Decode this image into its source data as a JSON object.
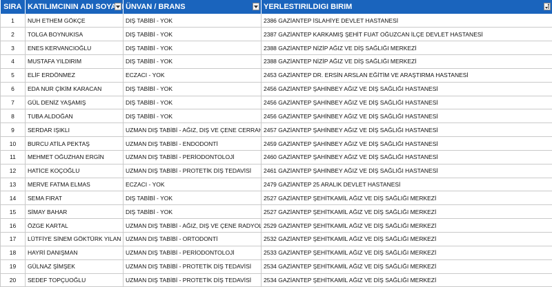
{
  "headers": {
    "sira": "SIRA",
    "name": "KATILIMCININ ADI SOYADI",
    "unvan": "ÜNVAN / BRANS",
    "birim": "YERLESTIRILDIGI BIRIM"
  },
  "icons": {
    "filter": "dropdown-filter-icon",
    "sorted_filter": "sort-filter-icon"
  },
  "colors": {
    "header_bg": "#1a64bd",
    "header_text": "#ffffff",
    "grid": "#c9c9c9"
  },
  "rows": [
    {
      "sira": "1",
      "name": "NUH ETHEM GÖKÇE",
      "unvan": "DIŞ TABİBİ - YOK",
      "birim": "2386 GAZİANTEP İSLAHİYE DEVLET HASTANESİ"
    },
    {
      "sira": "2",
      "name": "TOLGA BOYNUKISA",
      "unvan": "DIŞ TABİBİ - YOK",
      "birim": "2387 GAZİANTEP KARKAMIŞ ŞEHİT FUAT OĞUZCAN İLÇE DEVLET HASTANESİ"
    },
    {
      "sira": "3",
      "name": "ENES KERVANCIOĞLU",
      "unvan": "DIŞ TABİBİ - YOK",
      "birim": "2388 GAZİANTEP NİZİP AĞIZ VE DİŞ SAĞLIĞI MERKEZİ"
    },
    {
      "sira": "4",
      "name": "MUSTAFA YILDIRIM",
      "unvan": "DIŞ TABİBİ - YOK",
      "birim": "2388 GAZİANTEP NİZİP AĞIZ VE DİŞ SAĞLIĞI MERKEZİ"
    },
    {
      "sira": "5",
      "name": "ELİF ERDÖNMEZ",
      "unvan": "ECZACI - YOK",
      "birim": "2453 GAZİANTEP DR. ERSİN ARSLAN EĞİTİM VE ARAŞTIRMA HASTANESİ"
    },
    {
      "sira": "6",
      "name": "EDA NUR ÇİKİM KARACAN",
      "unvan": "DIŞ TABİBİ - YOK",
      "birim": "2456 GAZİANTEP ŞAHİNBEY AĞIZ VE DİŞ SAĞLIĞI HASTANESİ"
    },
    {
      "sira": "7",
      "name": "GÜL DENİZ YAŞAMIŞ",
      "unvan": "DIŞ TABİBİ - YOK",
      "birim": "2456 GAZİANTEP ŞAHİNBEY AĞIZ VE DİŞ SAĞLIĞI HASTANESİ"
    },
    {
      "sira": "8",
      "name": "TUBA ALDOĞAN",
      "unvan": "DIŞ TABİBİ - YOK",
      "birim": "2456 GAZİANTEP ŞAHİNBEY AĞIZ VE DİŞ SAĞLIĞI HASTANESİ"
    },
    {
      "sira": "9",
      "name": "SERDAR IŞIKLI",
      "unvan": "UZMAN DIŞ TABİBİ - AĞIZ, DIŞ VE ÇENE CERRAHİSİ",
      "birim": "2457 GAZİANTEP ŞAHİNBEY AĞIZ VE DİŞ SAĞLIĞI HASTANESİ"
    },
    {
      "sira": "10",
      "name": "BURCU ATİLA PEKTAŞ",
      "unvan": "UZMAN DIŞ TABİBİ - ENDODONTİ",
      "birim": "2459 GAZİANTEP ŞAHİNBEY AĞIZ VE DİŞ SAĞLIĞI HASTANESİ"
    },
    {
      "sira": "11",
      "name": "MEHMET OĞUZHAN ERGİN",
      "unvan": "UZMAN DIŞ TABİBİ - PERİODONTOLOJİ",
      "birim": "2460 GAZİANTEP ŞAHİNBEY AĞIZ VE DİŞ SAĞLIĞI HASTANESİ"
    },
    {
      "sira": "12",
      "name": "HATİCE KOÇOĞLU",
      "unvan": "UZMAN DIŞ TABİBİ - PROTETİK DİŞ TEDAVİSİ",
      "birim": "2461 GAZİANTEP ŞAHİNBEY AĞIZ VE DİŞ SAĞLIĞI HASTANESİ"
    },
    {
      "sira": "13",
      "name": "MERVE FATMA ELMAS",
      "unvan": "ECZACI - YOK",
      "birim": "2479 GAZİANTEP 25 ARALIK DEVLET HASTANESİ"
    },
    {
      "sira": "14",
      "name": "SEMA FIRAT",
      "unvan": "DIŞ TABİBİ - YOK",
      "birim": "2527 GAZİANTEP ŞEHİTKAMİL AĞIZ VE DİŞ SAĞLIĞI MERKEZİ"
    },
    {
      "sira": "15",
      "name": "SİMAY BAHAR",
      "unvan": "DIŞ TABİBİ - YOK",
      "birim": "2527 GAZİANTEP ŞEHİTKAMİL AĞIZ VE DİŞ SAĞLIĞI MERKEZİ"
    },
    {
      "sira": "16",
      "name": "ÖZGE KARTAL",
      "unvan": "UZMAN DIŞ TABİBİ - AĞIZ, DIŞ VE ÇENE RADYOLOJİSİ",
      "birim": "2529 GAZİANTEP ŞEHİTKAMİL AĞIZ VE DİŞ SAĞLIĞI MERKEZİ"
    },
    {
      "sira": "17",
      "name": "LÜTFİYE SİNEM GÖKTÜRK YILAN",
      "unvan": "UZMAN DIŞ TABİBİ - ORTODONTİ",
      "birim": "2532 GAZİANTEP ŞEHİTKAMİL AĞIZ VE DİŞ SAĞLIĞI MERKEZİ"
    },
    {
      "sira": "18",
      "name": "HAYRİ DANIŞMAN",
      "unvan": "UZMAN DIŞ TABİBİ - PERİODONTOLOJİ",
      "birim": "2533 GAZİANTEP ŞEHİTKAMİL AĞIZ VE DİŞ SAĞLIĞI MERKEZİ"
    },
    {
      "sira": "19",
      "name": "GÜLNAZ ŞİMŞEK",
      "unvan": "UZMAN DIŞ TABİBİ - PROTETİK DİŞ TEDAVİSİ",
      "birim": "2534 GAZİANTEP ŞEHİTKAMİL AĞIZ VE DİŞ SAĞLIĞI MERKEZİ"
    },
    {
      "sira": "20",
      "name": "SEDEF TOPÇUOĞLU",
      "unvan": "UZMAN DIŞ TABİBİ - PROTETİK DİŞ TEDAVİSİ",
      "birim": "2534 GAZİANTEP ŞEHİTKAMİL AĞIZ VE DİŞ SAĞLIĞI MERKEZİ"
    }
  ]
}
